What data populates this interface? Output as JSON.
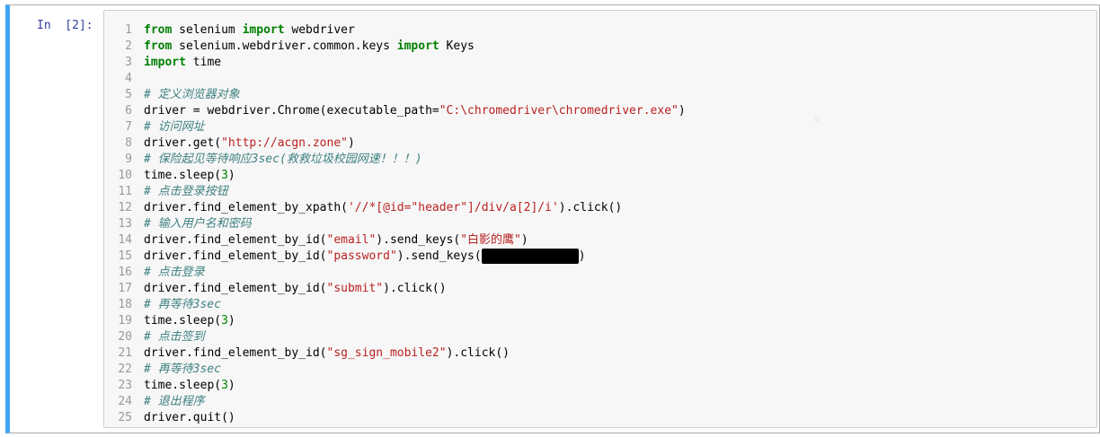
{
  "cell": {
    "prompt": "In  [2]:",
    "accent_color": "#42a5f5"
  },
  "code": {
    "lines": [
      {
        "n": "1",
        "segs": [
          {
            "t": "from",
            "c": "kw"
          },
          {
            "t": " selenium ",
            "c": ""
          },
          {
            "t": "import",
            "c": "kw"
          },
          {
            "t": " webdriver",
            "c": ""
          }
        ]
      },
      {
        "n": "2",
        "segs": [
          {
            "t": "from",
            "c": "kw"
          },
          {
            "t": " selenium.webdriver.common.keys ",
            "c": ""
          },
          {
            "t": "import",
            "c": "kw"
          },
          {
            "t": " Keys",
            "c": ""
          }
        ]
      },
      {
        "n": "3",
        "segs": [
          {
            "t": "import",
            "c": "kw"
          },
          {
            "t": " time",
            "c": ""
          }
        ]
      },
      {
        "n": "4",
        "segs": []
      },
      {
        "n": "5",
        "segs": [
          {
            "t": "# 定义浏览器对象",
            "c": "cm"
          }
        ]
      },
      {
        "n": "6",
        "segs": [
          {
            "t": "driver = webdriver.Chrome(executable_path=",
            "c": ""
          },
          {
            "t": "\"C:\\chromedriver\\chromedriver.exe\"",
            "c": "str"
          },
          {
            "t": ")",
            "c": ""
          }
        ]
      },
      {
        "n": "7",
        "segs": [
          {
            "t": "# 访问网址",
            "c": "cm"
          }
        ]
      },
      {
        "n": "8",
        "segs": [
          {
            "t": "driver.get(",
            "c": ""
          },
          {
            "t": "\"http://acgn.zone\"",
            "c": "str"
          },
          {
            "t": ")",
            "c": ""
          }
        ]
      },
      {
        "n": "9",
        "segs": [
          {
            "t": "# 保险起见等待响应3sec(救救垃圾校园网速！！！)",
            "c": "cm"
          }
        ]
      },
      {
        "n": "10",
        "segs": [
          {
            "t": "time.sleep(",
            "c": ""
          },
          {
            "t": "3",
            "c": "num"
          },
          {
            "t": ")",
            "c": ""
          }
        ]
      },
      {
        "n": "11",
        "segs": [
          {
            "t": "# 点击登录按钮",
            "c": "cm"
          }
        ]
      },
      {
        "n": "12",
        "segs": [
          {
            "t": "driver.find_element_by_xpath(",
            "c": ""
          },
          {
            "t": "'//*[@id=\"header\"]/div/a[2]/i'",
            "c": "str"
          },
          {
            "t": ").click()",
            "c": ""
          }
        ]
      },
      {
        "n": "13",
        "segs": [
          {
            "t": "# 输入用户名和密码",
            "c": "cm"
          }
        ]
      },
      {
        "n": "14",
        "segs": [
          {
            "t": "driver.find_element_by_id(",
            "c": ""
          },
          {
            "t": "\"email\"",
            "c": "str"
          },
          {
            "t": ").send_keys(",
            "c": ""
          },
          {
            "t": "\"白影的鹰\"",
            "c": "str"
          },
          {
            "t": ")",
            "c": ""
          }
        ]
      },
      {
        "n": "15",
        "segs": [
          {
            "t": "driver.find_element_by_id(",
            "c": ""
          },
          {
            "t": "\"password\"",
            "c": "str"
          },
          {
            "t": ").send_keys(",
            "c": ""
          },
          {
            "t": "",
            "c": "redact"
          },
          {
            "t": ")",
            "c": ""
          }
        ]
      },
      {
        "n": "16",
        "segs": [
          {
            "t": "# 点击登录",
            "c": "cm"
          }
        ]
      },
      {
        "n": "17",
        "segs": [
          {
            "t": "driver.find_element_by_id(",
            "c": ""
          },
          {
            "t": "\"submit\"",
            "c": "str"
          },
          {
            "t": ").click()",
            "c": ""
          }
        ]
      },
      {
        "n": "18",
        "segs": [
          {
            "t": "# 再等待3sec",
            "c": "cm"
          }
        ]
      },
      {
        "n": "19",
        "segs": [
          {
            "t": "time.sleep(",
            "c": ""
          },
          {
            "t": "3",
            "c": "num"
          },
          {
            "t": ")",
            "c": ""
          }
        ]
      },
      {
        "n": "20",
        "segs": [
          {
            "t": "# 点击签到",
            "c": "cm"
          }
        ]
      },
      {
        "n": "21",
        "segs": [
          {
            "t": "driver.find_element_by_id(",
            "c": ""
          },
          {
            "t": "\"sg_sign_mobile2\"",
            "c": "str"
          },
          {
            "t": ").click()",
            "c": ""
          }
        ]
      },
      {
        "n": "22",
        "segs": [
          {
            "t": "# 再等待3sec",
            "c": "cm"
          }
        ]
      },
      {
        "n": "23",
        "segs": [
          {
            "t": "time.sleep(",
            "c": ""
          },
          {
            "t": "3",
            "c": "num"
          },
          {
            "t": ")",
            "c": ""
          }
        ]
      },
      {
        "n": "24",
        "segs": [
          {
            "t": "# 退出程序",
            "c": "cm"
          }
        ]
      },
      {
        "n": "25",
        "segs": [
          {
            "t": "driver.quit()",
            "c": ""
          }
        ]
      }
    ]
  }
}
